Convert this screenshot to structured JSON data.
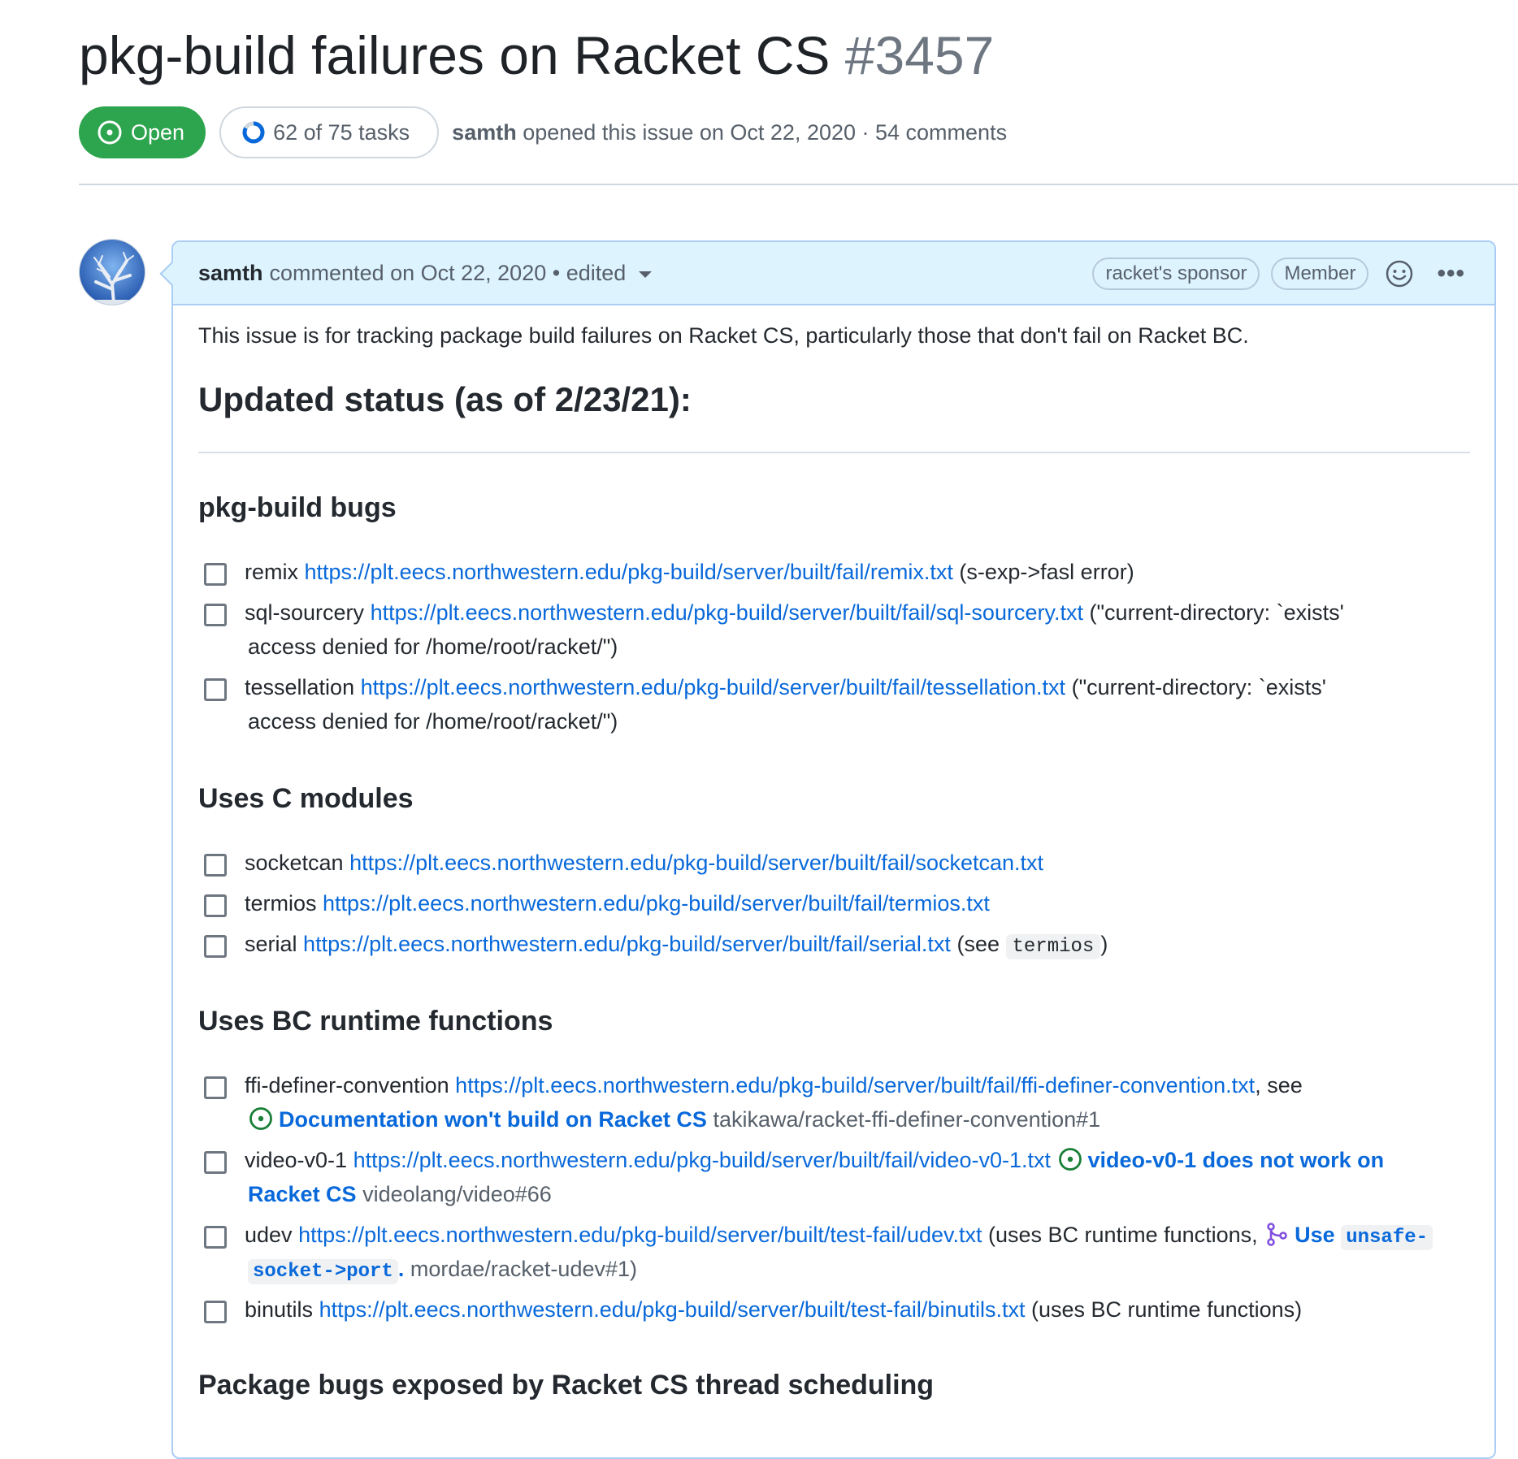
{
  "issue": {
    "title": "pkg-build failures on Racket CS",
    "number": "#3457",
    "state": "Open",
    "tasks": "62 of 75 tasks",
    "author": "samth",
    "opened_text": "opened this issue on Oct 22, 2020 · 54 comments"
  },
  "comment": {
    "author": "samth",
    "meta": "commented on Oct 22, 2020 • edited",
    "badges": [
      "racket's sponsor",
      "Member"
    ],
    "intro": "This issue is for tracking package build failures on Racket CS, particularly those that don't fail on Racket BC.",
    "status_heading": "Updated status (as of 2/23/21):",
    "sections": {
      "pkg_build_bugs": {
        "heading": "pkg-build bugs",
        "tasks": [
          {
            "name": "remix",
            "url": "https://plt.eecs.northwestern.edu/pkg-build/server/built/fail/remix.txt",
            "note": "(s-exp->fasl error)"
          },
          {
            "name": "sql-sourcery",
            "url": "https://plt.eecs.northwestern.edu/pkg-build/server/built/fail/sql-sourcery.txt",
            "note": "(\"current-directory: `exists'",
            "note2": "access denied for /home/root/racket/\")"
          },
          {
            "name": "tessellation",
            "url": "https://plt.eecs.northwestern.edu/pkg-build/server/built/fail/tessellation.txt",
            "note": "(\"current-directory: `exists'",
            "note2": "access denied for /home/root/racket/\")"
          }
        ]
      },
      "c_modules": {
        "heading": "Uses C modules",
        "tasks": [
          {
            "name": "socketcan",
            "url": "https://plt.eecs.northwestern.edu/pkg-build/server/built/fail/socketcan.txt"
          },
          {
            "name": "termios",
            "url": "https://plt.eecs.northwestern.edu/pkg-build/server/built/fail/termios.txt"
          },
          {
            "name": "serial",
            "url": "https://plt.eecs.northwestern.edu/pkg-build/server/built/fail/serial.txt",
            "note_pre": "(see",
            "code": "termios",
            "note_post": ")"
          }
        ]
      },
      "bc_runtime": {
        "heading": "Uses BC runtime functions",
        "tasks": [
          {
            "name": "ffi-definer-convention",
            "url": "https://plt.eecs.northwestern.edu/pkg-build/server/built/fail/ffi-definer-convention.txt",
            "sep": ", see",
            "ref_title": "Documentation won't build on Racket CS",
            "ref_tail": "takikawa/racket-ffi-definer-convention#1"
          },
          {
            "name": "video-v0-1",
            "url": "https://plt.eecs.northwestern.edu/pkg-build/server/built/fail/video-v0-1.txt",
            "ref_title_1": "video-v0-1 does not work on",
            "ref_title_2": "Racket CS",
            "ref_tail": "videolang/video#66"
          },
          {
            "name": "udev",
            "url": "https://plt.eecs.northwestern.edu/pkg-build/server/built/test-fail/udev.txt",
            "note_pre": "(uses BC runtime functions,",
            "pr_title": "Use",
            "code_1": "unsafe-",
            "code_2": "socket->port",
            "code_dot": ".",
            "ref_tail": "mordae/racket-udev#1)"
          },
          {
            "name": "binutils",
            "url": "https://plt.eecs.northwestern.edu/pkg-build/server/built/test-fail/binutils.txt",
            "note": "(uses BC runtime functions)"
          }
        ]
      },
      "thread_sched": {
        "heading": "Package bugs exposed by Racket CS thread scheduling"
      }
    }
  },
  "colors": {
    "open_green": "#2da44e",
    "link_blue": "#0969da",
    "header_bg": "#ddf4ff",
    "pr_purple": "#8250df"
  },
  "icons": [
    "issue-open-icon",
    "task-progress-icon",
    "smiley-icon",
    "kebab-icon",
    "git-merge-icon",
    "checkbox-icon"
  ]
}
